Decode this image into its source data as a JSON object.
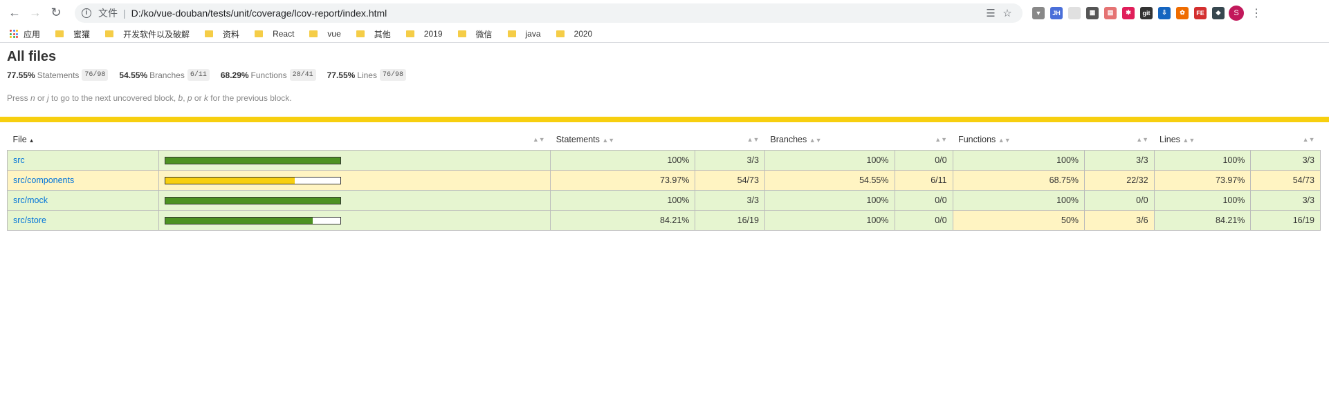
{
  "browser": {
    "scheme_label": "文件",
    "url": "D:/ko/vue-douban/tests/unit/coverage/lcov-report/index.html",
    "avatar_letter": "S",
    "extensions": [
      {
        "name": "vuejs-icon",
        "text": "▼",
        "color": "#888888"
      },
      {
        "name": "jh-extension-icon",
        "text": "JH",
        "color": "#4a6fd9"
      },
      {
        "name": "blank-extension-icon",
        "text": "",
        "color": "#e0e0e0"
      },
      {
        "name": "qr-code-icon",
        "text": "▦",
        "color": "#555555"
      },
      {
        "name": "clip-extension-icon",
        "text": "▤",
        "color": "#e57373"
      },
      {
        "name": "slack-icon",
        "text": "✱",
        "color": "#e01e5a"
      },
      {
        "name": "gitzip-icon",
        "text": "git",
        "color": "#333333"
      },
      {
        "name": "save-extension-icon",
        "text": "⇩",
        "color": "#1565c0"
      },
      {
        "name": "orange-extension-icon",
        "text": "✿",
        "color": "#ef6c00"
      },
      {
        "name": "fe-helper-icon",
        "text": "FE",
        "color": "#d32f2f"
      },
      {
        "name": "bird-extension-icon",
        "text": "◆",
        "color": "#37474f"
      }
    ]
  },
  "bookmarks": {
    "apps_label": "应用",
    "items": [
      "蜜獾",
      "开发软件以及破解",
      "资料",
      "React",
      "vue",
      "其他",
      "2019",
      "微信",
      "java",
      "2020"
    ]
  },
  "report": {
    "title": "All files",
    "summary": [
      {
        "pct": "77.55%",
        "label": "Statements",
        "fraction": "76/98"
      },
      {
        "pct": "54.55%",
        "label": "Branches",
        "fraction": "6/11"
      },
      {
        "pct": "68.29%",
        "label": "Functions",
        "fraction": "28/41"
      },
      {
        "pct": "77.55%",
        "label": "Lines",
        "fraction": "76/98"
      }
    ],
    "hint_parts": [
      "Press ",
      "n",
      " or ",
      "j",
      " to go to the next uncovered block, ",
      "b",
      ", ",
      "p",
      " or ",
      "k",
      " for the previous block."
    ],
    "columns": {
      "file": "File",
      "statements": "Statements",
      "branches": "Branches",
      "functions": "Functions",
      "lines": "Lines"
    },
    "colors": {
      "high": "#4d9221",
      "medium": "#f7cf0f",
      "status_line": "#f7cf0f"
    },
    "rows": [
      {
        "file": "src",
        "coverage": 100,
        "level": "high",
        "stmt_pct": "100%",
        "stmt": "3/3",
        "br_pct": "100%",
        "br": "0/0",
        "fn_pct": "100%",
        "fn": "3/3",
        "fn_level": "high",
        "ln_pct": "100%",
        "ln": "3/3"
      },
      {
        "file": "src/components",
        "coverage": 73.97,
        "level": "medium",
        "stmt_pct": "73.97%",
        "stmt": "54/73",
        "br_pct": "54.55%",
        "br": "6/11",
        "fn_pct": "68.75%",
        "fn": "22/32",
        "fn_level": "medium",
        "ln_pct": "73.97%",
        "ln": "54/73"
      },
      {
        "file": "src/mock",
        "coverage": 100,
        "level": "high",
        "stmt_pct": "100%",
        "stmt": "3/3",
        "br_pct": "100%",
        "br": "0/0",
        "fn_pct": "100%",
        "fn": "0/0",
        "fn_level": "high",
        "ln_pct": "100%",
        "ln": "3/3"
      },
      {
        "file": "src/store",
        "coverage": 84.21,
        "level": "high",
        "stmt_pct": "84.21%",
        "stmt": "16/19",
        "br_pct": "100%",
        "br": "0/0",
        "fn_pct": "50%",
        "fn": "3/6",
        "fn_level": "medium",
        "ln_pct": "84.21%",
        "ln": "16/19"
      }
    ]
  }
}
